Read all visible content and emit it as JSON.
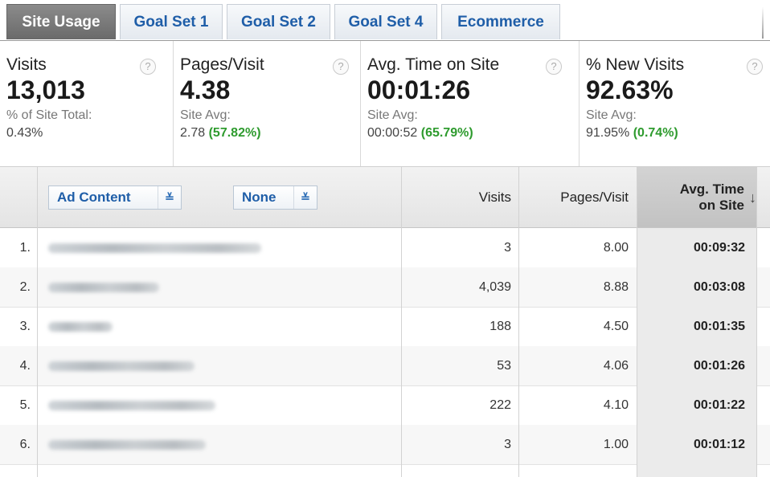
{
  "tabs": [
    "Site Usage",
    "Goal Set 1",
    "Goal Set 2",
    "Goal Set 4",
    "Ecommerce"
  ],
  "metrics": [
    {
      "title": "Visits",
      "value": "13,013",
      "sub_label": "% of Site Total:",
      "sub_value": "0.43%",
      "sub_delta": ""
    },
    {
      "title": "Pages/Visit",
      "value": "4.38",
      "sub_label": "Site Avg:",
      "sub_value": "2.78",
      "sub_delta": "(57.82%)"
    },
    {
      "title": "Avg. Time on Site",
      "value": "00:01:26",
      "sub_label": "Site Avg:",
      "sub_value": "00:00:52",
      "sub_delta": "(65.79%)"
    },
    {
      "title": "% New Visits",
      "value": "92.63%",
      "sub_label": "Site Avg:",
      "sub_value": "91.95%",
      "sub_delta": "(0.74%)"
    }
  ],
  "help_glyph": "?",
  "table": {
    "primary_dimension": "Ad Content",
    "secondary_dimension": "None",
    "chevron": "≚",
    "headers": {
      "visits": "Visits",
      "pages_visit": "Pages/Visit",
      "avg_time_line1": "Avg. Time",
      "avg_time_line2": "on Site",
      "sort_arrow": "↓"
    },
    "rows": [
      {
        "index": "1.",
        "visits": "3",
        "pages_visit": "8.00",
        "avg_time": "00:09:32"
      },
      {
        "index": "2.",
        "visits": "4,039",
        "pages_visit": "8.88",
        "avg_time": "00:03:08"
      },
      {
        "index": "3.",
        "visits": "188",
        "pages_visit": "4.50",
        "avg_time": "00:01:35"
      },
      {
        "index": "4.",
        "visits": "53",
        "pages_visit": "4.06",
        "avg_time": "00:01:26"
      },
      {
        "index": "5.",
        "visits": "222",
        "pages_visit": "4.10",
        "avg_time": "00:01:22"
      },
      {
        "index": "6.",
        "visits": "3",
        "pages_visit": "1.00",
        "avg_time": "00:01:12"
      }
    ]
  }
}
